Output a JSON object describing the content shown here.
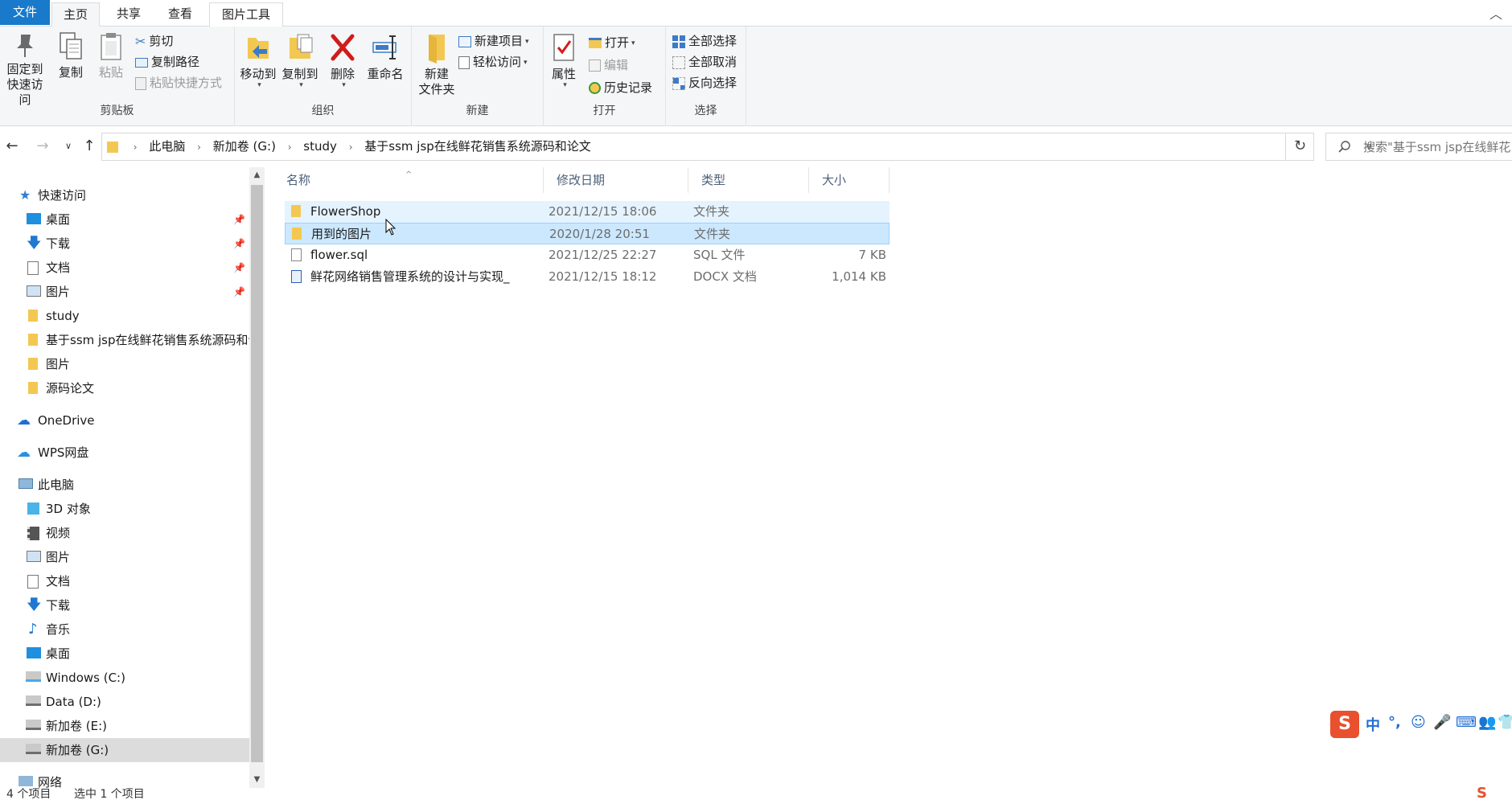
{
  "ribbon_tabs": {
    "file": "文件",
    "home": "主页",
    "share": "共享",
    "view": "查看",
    "picture_tools": "图片工具"
  },
  "ribbon": {
    "clipboard": {
      "pin_label_1": "固定到",
      "pin_label_2": "快速访问",
      "copy": "复制",
      "paste": "粘贴",
      "cut": "剪切",
      "copy_path": "复制路径",
      "paste_shortcut": "粘贴快捷方式",
      "group_label": "剪贴板"
    },
    "organize": {
      "move_to": "移动到",
      "copy_to": "复制到",
      "delete": "删除",
      "rename": "重命名",
      "group_label": "组织"
    },
    "new": {
      "new_folder_1": "新建",
      "new_folder_2": "文件夹",
      "new_item": "新建项目",
      "easy_access": "轻松访问",
      "group_label": "新建"
    },
    "open": {
      "properties": "属性",
      "open": "打开",
      "edit": "编辑",
      "history": "历史记录",
      "group_label": "打开"
    },
    "select": {
      "select_all": "全部选择",
      "select_none": "全部取消",
      "invert": "反向选择",
      "group_label": "选择"
    }
  },
  "address": {
    "crumbs": [
      "此电脑",
      "新加卷 (G:)",
      "study",
      "基于ssm jsp在线鲜花销售系统源码和论文"
    ],
    "search_placeholder": "搜索\"基于ssm jsp在线鲜花..."
  },
  "nav": {
    "quick_access": "快速访问",
    "items": [
      {
        "label": "桌面",
        "pinned": true
      },
      {
        "label": "下载",
        "pinned": true
      },
      {
        "label": "文档",
        "pinned": true
      },
      {
        "label": "图片",
        "pinned": true
      },
      {
        "label": "study",
        "pinned": false
      },
      {
        "label": "基于ssm jsp在线鲜花销售系统源码和论文",
        "pinned": false
      },
      {
        "label": "图片",
        "pinned": false
      },
      {
        "label": "源码论文",
        "pinned": false
      }
    ],
    "onedrive": "OneDrive",
    "wps": "WPS网盘",
    "this_pc": "此电脑",
    "pc_items": [
      "3D 对象",
      "视频",
      "图片",
      "文档",
      "下载",
      "音乐",
      "桌面",
      "Windows (C:)",
      "Data (D:)",
      "新加卷 (E:)",
      "新加卷 (G:)"
    ],
    "network": "网络"
  },
  "columns": {
    "name": "名称",
    "date": "修改日期",
    "type": "类型",
    "size": "大小"
  },
  "files": [
    {
      "name": "FlowerShop",
      "date": "2021/12/15 18:06",
      "type": "文件夹",
      "size": "",
      "icon": "folder"
    },
    {
      "name": "用到的图片",
      "date": "2020/1/28 20:51",
      "type": "文件夹",
      "size": "",
      "icon": "folder"
    },
    {
      "name": "flower.sql",
      "date": "2021/12/25 22:27",
      "type": "SQL 文件",
      "size": "7 KB",
      "icon": "file"
    },
    {
      "name": "鲜花网络销售管理系统的设计与实现_",
      "date": "2021/12/15 18:12",
      "type": "DOCX 文档",
      "size": "1,014 KB",
      "icon": "docx"
    }
  ],
  "status": {
    "count": "4 个项目",
    "selected": "选中 1 个项目"
  },
  "ime": {
    "lang": "中"
  },
  "colors": {
    "file_tab": "#1979ca",
    "selection": "#cce8ff",
    "hover": "#e5f3ff",
    "folder": "#f3c852"
  }
}
